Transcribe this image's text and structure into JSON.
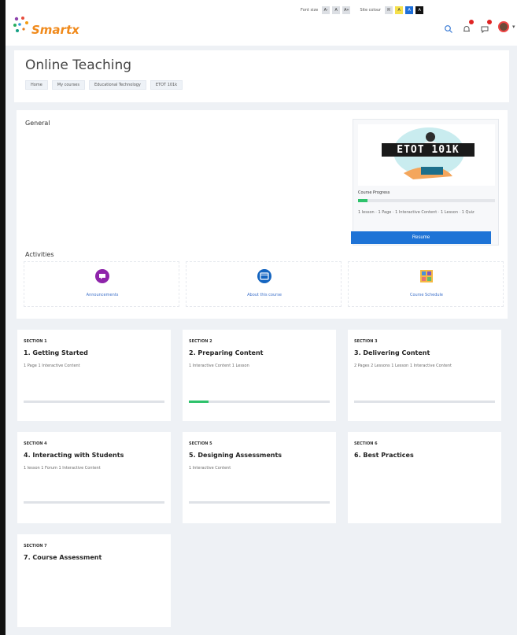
{
  "header": {
    "logo_text": "Smartx",
    "accessibility": {
      "font_label": "Font size",
      "font_buttons": [
        "A-",
        "A",
        "A+"
      ],
      "contrast_label": "Site colour",
      "contrast_buttons": [
        "R",
        "A",
        "A",
        "A"
      ]
    },
    "icons": [
      "search-icon",
      "bell-icon",
      "chat-icon",
      "avatar",
      "chevron-down-icon"
    ]
  },
  "course": {
    "title": "Online Teaching",
    "breadcrumb": [
      "Home",
      "My courses",
      "Educational Technology",
      "ETOT 101k"
    ],
    "general_label": "General",
    "panel": {
      "course_code": "ETOT 101K",
      "progress_label": "Course Progress",
      "progress_percent": 7,
      "meta": "1 lesson · 1 Page · 1 Interactive Content · 1 Lesson · 1 Quiz",
      "resume_label": "Resume"
    },
    "activities_label": "Activities",
    "activities": [
      {
        "label": "Announcements",
        "icon": "announcements-icon"
      },
      {
        "label": "About this course",
        "icon": "course-info-icon"
      },
      {
        "label": "Course Schedule",
        "icon": "schedule-icon"
      }
    ]
  },
  "sections": [
    {
      "number": "SECTION 1",
      "title": "1. Getting Started",
      "meta": "1 Page    1 Interactive Content",
      "progress_percent": 0
    },
    {
      "number": "SECTION 2",
      "title": "2. Preparing Content",
      "meta": "1 Interactive Content    1 Lesson",
      "progress_percent": 14
    },
    {
      "number": "SECTION 3",
      "title": "3. Delivering Content",
      "meta": "2 Pages    2 Lessons    1 Lesson    1 Interactive Content",
      "progress_percent": 0
    },
    {
      "number": "SECTION 4",
      "title": "4. Interacting with Students",
      "meta": "1 lesson    1 Forum    1 Interactive Content",
      "progress_percent": 0
    },
    {
      "number": "SECTION 5",
      "title": "5. Designing Assessments",
      "meta": "1 Interactive Content",
      "progress_percent": 0
    },
    {
      "number": "SECTION 6",
      "title": "6. Best Practices",
      "meta": "",
      "progress_percent": null
    },
    {
      "number": "SECTION 7",
      "title": "7. Course Assessment",
      "meta": "",
      "progress_percent": null
    }
  ],
  "colors": {
    "accent": "#1e73d6",
    "progress": "#2ec26b",
    "logo": "#f08a1c",
    "background": "#eef1f5"
  }
}
